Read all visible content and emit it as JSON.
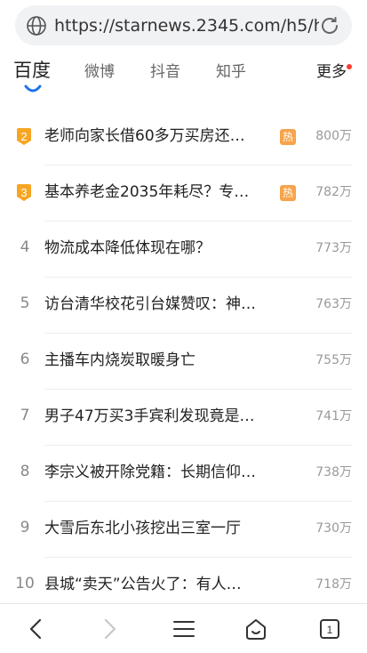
{
  "url_bar": {
    "url": "https://starnews.2345.com/h5/h",
    "icons": {
      "site": "globe-icon",
      "reload": "reload-icon"
    }
  },
  "tabs": [
    {
      "label": "百度",
      "active": true
    },
    {
      "label": "微博",
      "active": false
    },
    {
      "label": "抖音",
      "active": false
    },
    {
      "label": "知乎",
      "active": false
    },
    {
      "label": "更多",
      "active": false,
      "has_badge": true
    }
  ],
  "hot_list": [
    {
      "rank": "2",
      "title": "老师向家长借60多万买房还…",
      "hot": "热",
      "count": "800万"
    },
    {
      "rank": "3",
      "title": "基本养老金2035年耗尽？专…",
      "hot": "热",
      "count": "782万"
    },
    {
      "rank": "4",
      "title": "物流成本降低体现在哪？",
      "count": "773万"
    },
    {
      "rank": "5",
      "title": "访台清华校花引台媒赞叹：神…",
      "count": "763万"
    },
    {
      "rank": "6",
      "title": "主播车内烧炭取暖身亡",
      "count": "755万"
    },
    {
      "rank": "7",
      "title": "男子47万买3手宾利发现竟是…",
      "count": "741万"
    },
    {
      "rank": "8",
      "title": "李宗义被开除党籍：长期信仰…",
      "count": "738万"
    },
    {
      "rank": "9",
      "title": "大雪后东北小孩挖出三室一厅",
      "count": "730万"
    },
    {
      "rank": "10",
      "title": "县城“卖天”公告火了：有人…",
      "count": "718万"
    }
  ],
  "colors": {
    "accent": "#1a73e8",
    "rank_gold": "#f6a623",
    "hot_badge": "#f6a34a",
    "badge_dot": "#ff3b30"
  },
  "bottom_bar": {
    "tab_count": "1",
    "icons": [
      "back-icon",
      "forward-icon",
      "menu-icon",
      "home-icon",
      "tabs-icon"
    ]
  }
}
